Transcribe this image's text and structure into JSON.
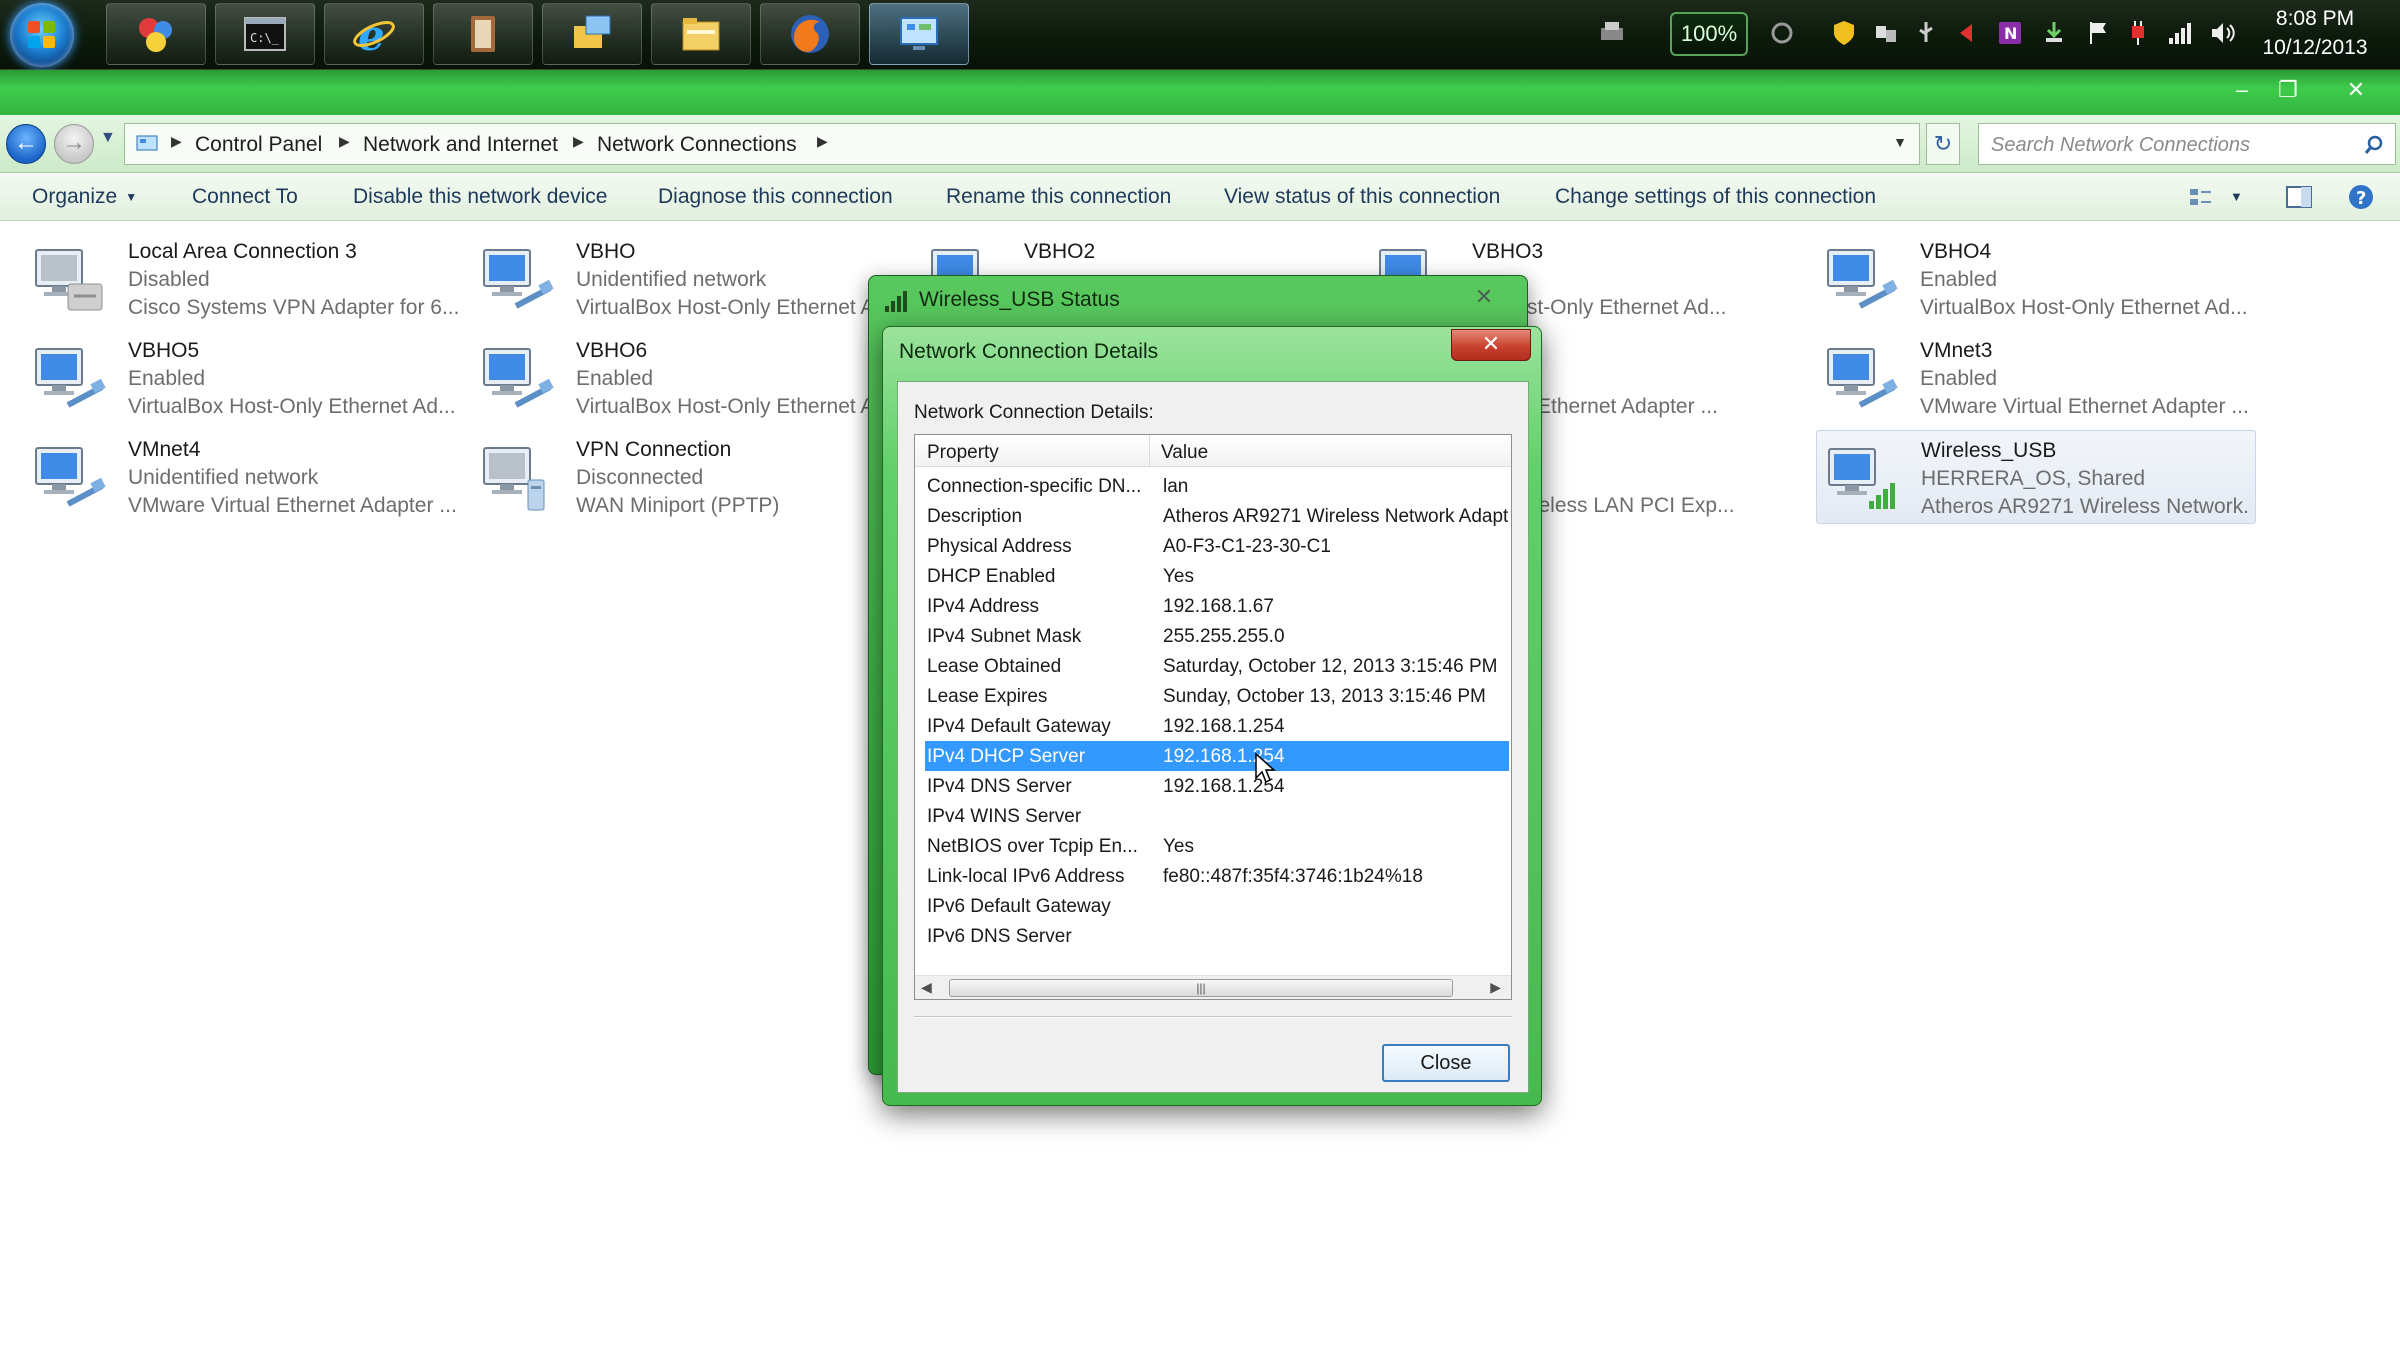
{
  "taskbar": {
    "buttons": [
      {
        "icon": "paint-shapes-icon",
        "active": false
      },
      {
        "icon": "command-prompt-icon",
        "active": false
      },
      {
        "icon": "internet-explorer-icon",
        "active": false
      },
      {
        "icon": "book-icon",
        "active": false
      },
      {
        "icon": "network-folders-icon",
        "active": false
      },
      {
        "icon": "file-explorer-icon",
        "active": false
      },
      {
        "icon": "firefox-icon",
        "active": false
      },
      {
        "icon": "control-panel-icon",
        "active": true
      }
    ],
    "battery_label": "100%",
    "clock_time": "8:08 PM",
    "clock_date": "10/12/2013"
  },
  "address": {
    "crumbs": [
      "Control Panel",
      "Network and Internet",
      "Network Connections"
    ],
    "search_placeholder": "Search Network Connections"
  },
  "commands": {
    "organize": "Organize",
    "connect_to": "Connect To",
    "disable": "Disable this network device",
    "diagnose": "Diagnose this connection",
    "rename": "Rename this connection",
    "view_status": "View status of this connection",
    "change_settings": "Change settings of this connection"
  },
  "connections": [
    {
      "name": "Local Area Connection 3",
      "status": "Disabled",
      "adapter": "Cisco Systems VPN Adapter for 6..."
    },
    {
      "name": "VBHO",
      "status": "Unidentified network",
      "adapter": "VirtualBox Host-Only Ethernet A"
    },
    {
      "name": "VBHO2",
      "status": "",
      "adapter": ""
    },
    {
      "name": "VBHO3",
      "status": "",
      "adapter": "ox Host-Only Ethernet Ad..."
    },
    {
      "name": "VBHO4",
      "status": "Enabled",
      "adapter": "VirtualBox Host-Only Ethernet Ad..."
    },
    {
      "name": "VBHO5",
      "status": "Enabled",
      "adapter": "VirtualBox Host-Only Ethernet Ad..."
    },
    {
      "name": "VBHO6",
      "status": "Enabled",
      "adapter": "VirtualBox Host-Only Ethernet A"
    },
    {
      "name": "",
      "status": "",
      "adapter": "Virtual Ethernet Adapter ..."
    },
    {
      "name": "VMnet3",
      "status": "Enabled",
      "adapter": "VMware Virtual Ethernet Adapter ..."
    },
    {
      "name": "VMnet4",
      "status": "Unidentified network",
      "adapter": "VMware Virtual Ethernet Adapter ..."
    },
    {
      "name": "VPN Connection",
      "status": "Disconnected",
      "adapter": "WAN Miniport (PPTP)"
    },
    {
      "name": "",
      "status": "ected",
      "adapter": "g/n Wireless LAN PCI Exp..."
    },
    {
      "name": "Wireless_USB",
      "status": "HERRERA_OS, Shared",
      "adapter": "Atheros AR9271 Wireless Network..."
    }
  ],
  "status_dialog": {
    "title": "Wireless_USB Status"
  },
  "details_dialog": {
    "title": "Network Connection Details",
    "label": "Network Connection Details:",
    "col_property": "Property",
    "col_value": "Value",
    "rows": [
      {
        "property": "Connection-specific DN...",
        "value": "lan"
      },
      {
        "property": "Description",
        "value": "Atheros AR9271 Wireless Network Adapt"
      },
      {
        "property": "Physical Address",
        "value": "A0-F3-C1-23-30-C1"
      },
      {
        "property": "DHCP Enabled",
        "value": "Yes"
      },
      {
        "property": "IPv4 Address",
        "value": "192.168.1.67"
      },
      {
        "property": "IPv4 Subnet Mask",
        "value": "255.255.255.0"
      },
      {
        "property": "Lease Obtained",
        "value": "Saturday, October 12, 2013 3:15:46 PM"
      },
      {
        "property": "Lease Expires",
        "value": "Sunday, October 13, 2013 3:15:46 PM"
      },
      {
        "property": "IPv4 Default Gateway",
        "value": "192.168.1.254"
      },
      {
        "property": "IPv4 DHCP Server",
        "value": "192.168.1.254"
      },
      {
        "property": "IPv4 DNS Server",
        "value": "192.168.1.254"
      },
      {
        "property": "IPv4 WINS Server",
        "value": ""
      },
      {
        "property": "NetBIOS over Tcpip En...",
        "value": "Yes"
      },
      {
        "property": "Link-local IPv6 Address",
        "value": "fe80::487f:35f4:3746:1b24%18"
      },
      {
        "property": "IPv6 Default Gateway",
        "value": ""
      },
      {
        "property": "IPv6 DNS Server",
        "value": ""
      }
    ],
    "selected_property": "IPv4 DHCP Server",
    "close_label": "Close"
  }
}
